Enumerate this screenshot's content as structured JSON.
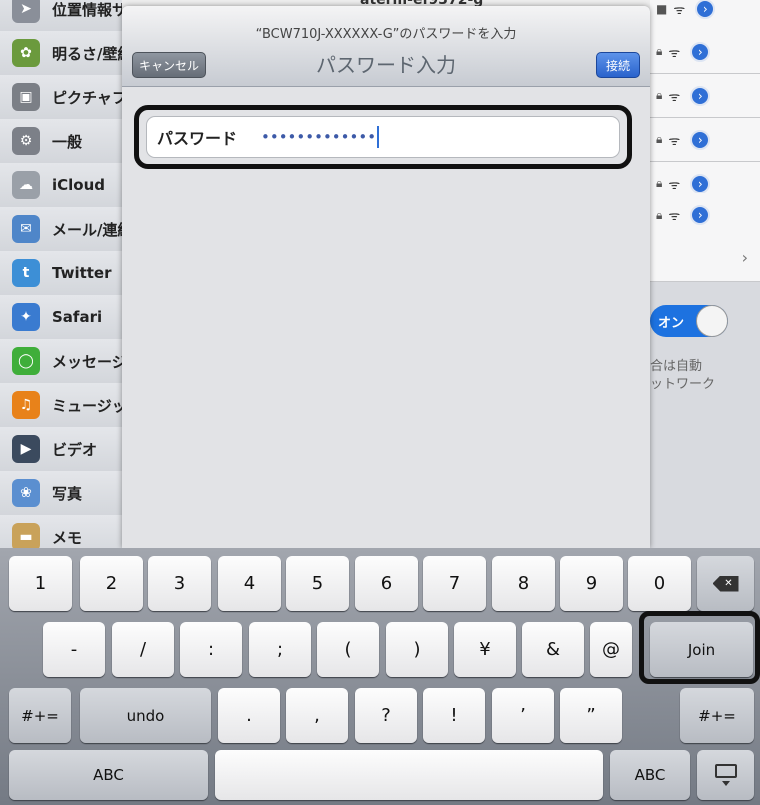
{
  "sidebar": {
    "items": [
      {
        "label": "位置情報サービス",
        "icon": "location-icon",
        "color": "#8a8f99"
      },
      {
        "label": "明るさ/壁紙",
        "icon": "wallpaper-icon",
        "color": "#6b9a3d"
      },
      {
        "label": "ピクチャフレーム",
        "icon": "picture-frame-icon",
        "color": "#7b7f86"
      },
      {
        "label": "一般",
        "icon": "gear-icon",
        "color": "#7c8088"
      },
      {
        "label": "iCloud",
        "icon": "cloud-icon",
        "color": "#9aa0a8"
      },
      {
        "label": "メール/連絡先/カレンダー",
        "icon": "mail-icon",
        "color": "#4f86c9"
      },
      {
        "label": "Twitter",
        "icon": "twitter-icon",
        "color": "#3d8fd6"
      },
      {
        "label": "Safari",
        "icon": "compass-icon",
        "color": "#3a7bd0"
      },
      {
        "label": "メッセージ",
        "icon": "message-icon",
        "color": "#3fae3a"
      },
      {
        "label": "ミュージック",
        "icon": "music-icon",
        "color": "#e8821a"
      },
      {
        "label": "ビデオ",
        "icon": "video-icon",
        "color": "#3b4a5e"
      },
      {
        "label": "写真",
        "icon": "sunflower-icon",
        "color": "#5b8fd0"
      },
      {
        "label": "メモ",
        "icon": "notes-icon",
        "color": "#c9a25a"
      }
    ]
  },
  "background": {
    "top_network": "aterm-ef9372-g",
    "toggle_label": "オン",
    "note_lines": [
      "合は自動",
      "ットワーク"
    ]
  },
  "modal": {
    "subtitle": "“BCW710J-XXXXXX-G”のパスワードを入力",
    "title": "パスワード入力",
    "cancel_label": "キャンセル",
    "connect_label": "接続",
    "field_label": "パスワード",
    "field_value": "•••••••••••••"
  },
  "keyboard": {
    "row1": [
      "1",
      "2",
      "3",
      "4",
      "5",
      "6",
      "7",
      "8",
      "9",
      "0"
    ],
    "row2": [
      "-",
      "/",
      ":",
      ";",
      "(",
      ")",
      "¥",
      "&",
      "@"
    ],
    "join_label": "Join",
    "row3_shift": "#+=",
    "undo_label": "undo",
    "row3": [
      ".",
      ",",
      "?",
      "!",
      "’",
      "”"
    ],
    "abc_label": "ABC"
  }
}
